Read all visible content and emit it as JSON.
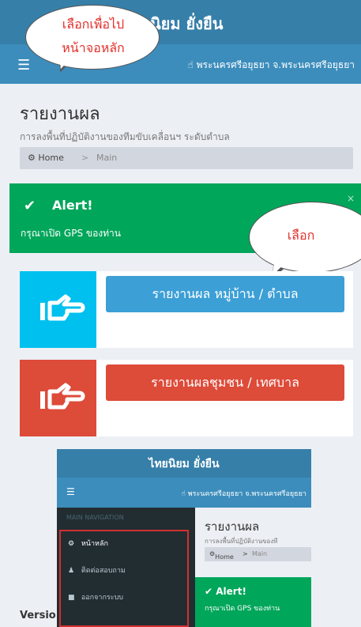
{
  "header": {
    "brand_visible": "นิยม ยั่งยืน",
    "menu_icon": "hamburger-icon",
    "location_icon": "hand-pointer-icon",
    "location": "พระนครศรีอยุธยา จ.พระนครศรีอยุธยา"
  },
  "callouts": {
    "home_line1": "เลือกเพื่อไป",
    "home_line2": "หน้าจอหลัก",
    "select": "เลือก"
  },
  "content": {
    "title": "รายงานผล",
    "subtitle": "การลงพื้นที่ปฏิบัติงานของทีมขับเคลื่อนฯ ระดับตำบล",
    "breadcrumb": {
      "home": "Home",
      "separator": ">",
      "current": "Main"
    }
  },
  "alert": {
    "icon": "check-icon",
    "title": "Alert!",
    "message": "กรุณาเปิด GPS ของท่าน",
    "close": "×"
  },
  "actions": [
    {
      "label": "รายงานผล หมู่บ้าน / ตำบล",
      "icon": "hand-point-right-icon",
      "color": "#00c0ef"
    },
    {
      "label": "รายงานผลชุมชน / เทศบาล",
      "icon": "hand-point-right-icon",
      "color": "#dd4b39"
    }
  ],
  "inset": {
    "brand": "ไทยนิยม ยั่งยืน",
    "location": "พระนครศรีอยุธยา จ.พระนครศรีอยุธยา",
    "nav_header": "MAIN NAVIGATION",
    "menu": [
      {
        "label": "หน้าหลัก",
        "icon": "dashboard-icon"
      },
      {
        "label": "ติดต่อสอบถาม",
        "icon": "user-icon"
      },
      {
        "label": "ออกจากระบบ",
        "icon": "lock-icon"
      }
    ],
    "title": "รายงานผล",
    "subtitle": "การลงพื้นที่ปฏิบัติงานของที",
    "breadcrumb": {
      "home": "Home",
      "separator": ">",
      "current": "Main"
    },
    "alert_title": "Alert!",
    "alert_message": "กรุณาเปิด GPS ของท่าน"
  },
  "footer": {
    "version": "Versio"
  },
  "colors": {
    "primary": "#3c8dbc",
    "success": "#00a65a",
    "info": "#00c0ef",
    "danger": "#dd4b39",
    "sidebar": "#222d32"
  }
}
